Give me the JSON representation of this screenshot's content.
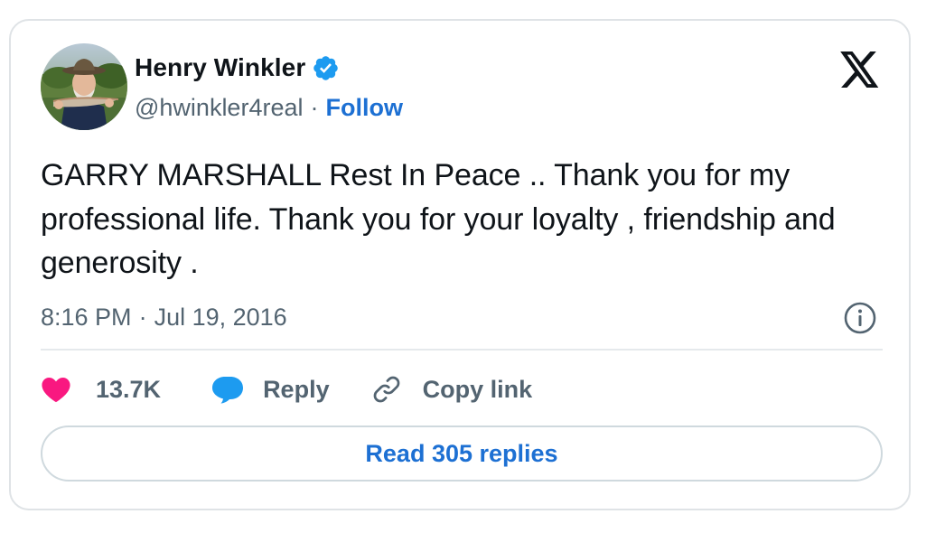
{
  "author": {
    "name": "Henry Winkler",
    "handle": "@hwinkler4real",
    "separator": "·",
    "follow_label": "Follow",
    "verified": true
  },
  "tweet": {
    "text": "GARRY MARSHALL Rest In Peace .. Thank you for my professional life. Thank you for your loyalty , friendship and generosity .",
    "time": "8:16 PM",
    "separator": "·",
    "date": "Jul 19, 2016"
  },
  "actions": {
    "like_count": "13.7K",
    "reply_label": "Reply",
    "copy_label": "Copy link"
  },
  "read_replies_label": "Read 305 replies",
  "icons": {
    "platform": "x-logo-icon",
    "verified": "verified-badge-icon",
    "info": "info-icon",
    "like": "heart-icon",
    "reply": "speech-bubble-icon",
    "copy": "link-icon"
  },
  "colors": {
    "accent": "#1d70d3",
    "verified": "#1d9bf0",
    "like": "#f91880",
    "text": "#0f1419",
    "muted": "#536471",
    "border": "#dfe3e6"
  }
}
